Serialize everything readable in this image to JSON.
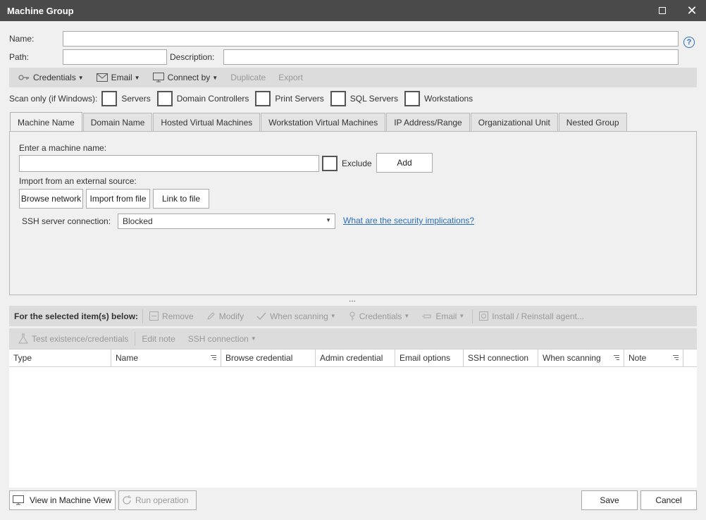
{
  "window": {
    "title": "Machine Group"
  },
  "form": {
    "name_label": "Name:",
    "name_value": "",
    "path_label": "Path:",
    "path_value": "",
    "description_label": "Description:",
    "description_value": "",
    "help": "?"
  },
  "toolbar": {
    "credentials": "Credentials",
    "email": "Email",
    "connect_by": "Connect by",
    "duplicate": "Duplicate",
    "export": "Export"
  },
  "scan": {
    "label": "Scan only (if Windows):",
    "options": [
      "Servers",
      "Domain Controllers",
      "Print Servers",
      "SQL Servers",
      "Workstations"
    ]
  },
  "tabs": [
    "Machine Name",
    "Domain Name",
    "Hosted Virtual Machines",
    "Workstation Virtual Machines",
    "IP Address/Range",
    "Organizational Unit",
    "Nested Group"
  ],
  "machine": {
    "enter_label": "Enter a machine name:",
    "value": "",
    "exclude_label": "Exclude",
    "add_button": "Add",
    "import_label": "Import from an external source:",
    "browse_network": "Browse network",
    "import_from_file": "Import from file",
    "link_to_file": "Link to file",
    "ssh_label": "SSH server connection:",
    "ssh_value": "Blocked",
    "security_link": "What are the security implications?"
  },
  "splitter": "...",
  "selected_toolbar": {
    "label": "For the selected item(s) below:",
    "remove": "Remove",
    "modify": "Modify",
    "when_scanning": "When scanning",
    "credentials": "Credentials",
    "email": "Email",
    "install": "Install / Reinstall agent...",
    "test": "Test existence/credentials",
    "edit_note": "Edit note",
    "ssh_connection": "SSH connection"
  },
  "grid": {
    "columns": [
      "Type",
      "Name",
      "Browse credential",
      "Admin credential",
      "Email options",
      "SSH connection",
      "When scanning",
      "Note"
    ],
    "rows": []
  },
  "footer": {
    "view_machine": "View in Machine View",
    "run_operation": "Run operation",
    "save": "Save",
    "cancel": "Cancel"
  },
  "colors": {
    "titlebar": "#4a4a4a",
    "link": "#2a6ebb",
    "toolbar": "#dcdcdc"
  }
}
